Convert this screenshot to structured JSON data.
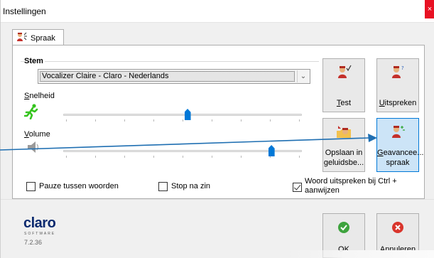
{
  "window": {
    "title": "Instellingen",
    "close_glyph": "×"
  },
  "tabs": [
    {
      "label": "Spraak",
      "icon": "speaker-person-icon"
    }
  ],
  "voice_group": {
    "label": "Stem",
    "voice": "Vocalizer Claire - Claro - Nederlands",
    "speed_label_accel": "S",
    "speed_label_rest": "nelheid",
    "volume_label_accel": "V",
    "volume_label_rest": "olume",
    "speed_level": 0.52,
    "volume_level": 0.88
  },
  "buttons": {
    "test": {
      "accel": "T",
      "rest": "est"
    },
    "speak": {
      "accel": "U",
      "rest": "itspreken"
    },
    "save_line1": "Opslaan in",
    "save_line2_accel": "g",
    "save_line2_rest": "eluidsbe...",
    "advanced_line1_accel": "G",
    "advanced_line1_rest": "eavancee...",
    "advanced_line2": "spraak",
    "ok": "OK",
    "cancel": "Annuleren"
  },
  "options": {
    "pause_words": {
      "label": "Pauze tussen woorden",
      "checked": false
    },
    "stop_after_sentence": {
      "label": "Stop na zin",
      "checked": false
    },
    "speak_ctrl": {
      "label_line1": "Woord uitspreken bij Ctrl +",
      "label_line2": "aanwijzen",
      "checked": true
    }
  },
  "footer": {
    "logo": "claro",
    "logo_sub": "SOFTWARE",
    "version": "7.2.36"
  },
  "colors": {
    "accent": "#0078d7",
    "arrow": "#1f6fb2",
    "runner": "#35c41e",
    "ok": "#3ea33e",
    "cancel": "#d9352c"
  }
}
